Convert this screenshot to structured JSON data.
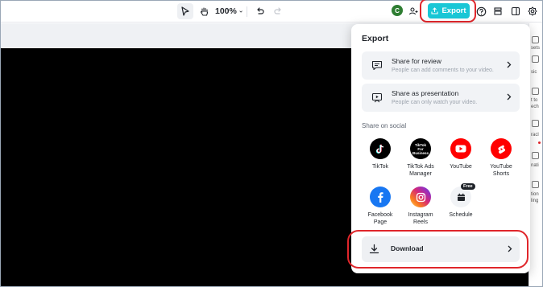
{
  "toolbar": {
    "zoom": "100%",
    "avatar_initial": "C",
    "export_label": "Export"
  },
  "export_panel": {
    "title": "Export",
    "share_review": {
      "title": "Share for review",
      "subtitle": "People can add comments to your video."
    },
    "share_presentation": {
      "title": "Share as presentation",
      "subtitle": "People can only watch your video."
    },
    "social_label": "Share on social",
    "social": [
      {
        "label": "TikTok",
        "icon": "tiktok-icon"
      },
      {
        "label": "TikTok Ads Manager",
        "icon": "tiktok-business-icon",
        "badge": "TikTok For Business"
      },
      {
        "label": "YouTube",
        "icon": "youtube-icon"
      },
      {
        "label": "YouTube Shorts",
        "icon": "youtube-shorts-icon"
      },
      {
        "label": "Facebook Page",
        "icon": "facebook-icon"
      },
      {
        "label": "Instagram Reels",
        "icon": "instagram-icon"
      },
      {
        "label": "Schedule",
        "icon": "calendar-icon",
        "badge": "Free"
      }
    ],
    "download_label": "Download"
  },
  "right_rail": [
    "sets",
    "sic",
    "t to",
    "ech",
    "racl",
    "nati",
    "tion",
    "ling"
  ],
  "colors": {
    "accent": "#19c7d6",
    "highlight": "#e0262b",
    "tiktok": "#000000",
    "youtube": "#ff0000",
    "facebook": "#1877f2"
  }
}
